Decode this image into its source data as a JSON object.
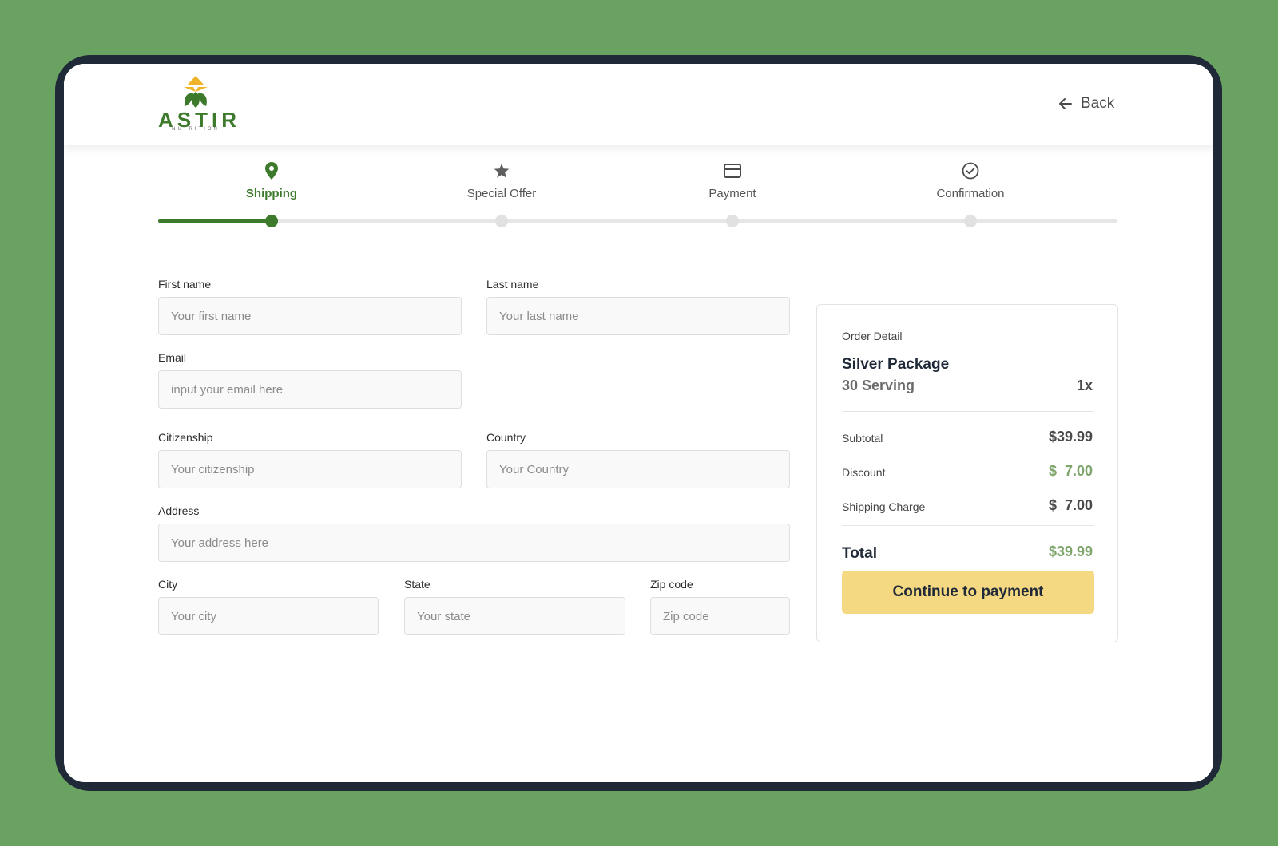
{
  "brand": {
    "name": "ASTIR",
    "tagline": "NUTRITION",
    "colors": {
      "primary_green": "#3d7a2b",
      "accent_yellow": "#f0b429",
      "button_yellow": "#f5d982",
      "page_background": "#6aa262"
    }
  },
  "header": {
    "back_label": "Back",
    "back_icon": "arrow-left-icon"
  },
  "stepper": {
    "active_index": 0,
    "steps": [
      {
        "label": "Shipping",
        "icon": "map-pin-icon"
      },
      {
        "label": "Special Offer",
        "icon": "star-icon"
      },
      {
        "label": "Payment",
        "icon": "credit-card-icon"
      },
      {
        "label": "Confirmation",
        "icon": "check-circle-icon"
      }
    ]
  },
  "form": {
    "first_name": {
      "label": "First name",
      "placeholder": "Your first name",
      "value": ""
    },
    "last_name": {
      "label": "Last name",
      "placeholder": "Your last name",
      "value": ""
    },
    "email": {
      "label": "Email",
      "placeholder": "input your email here",
      "value": ""
    },
    "citizenship": {
      "label": "Citizenship",
      "placeholder": "Your citizenship",
      "value": ""
    },
    "country": {
      "label": "Country",
      "placeholder": "Your Country",
      "value": ""
    },
    "address": {
      "label": "Address",
      "placeholder": "Your address here",
      "value": ""
    },
    "city": {
      "label": "City",
      "placeholder": "Your city",
      "value": ""
    },
    "state": {
      "label": "State",
      "placeholder": "Your state",
      "value": ""
    },
    "zip": {
      "label": "Zip code",
      "placeholder": "Zip code",
      "value": ""
    }
  },
  "order": {
    "heading": "Order Detail",
    "package_name": "Silver Package",
    "serving": "30 Serving",
    "quantity": "1x",
    "subtotal_label": "Subtotal",
    "subtotal_value": "$39.99",
    "discount_label": "Discount",
    "discount_value": "$  7.00",
    "shipping_label": "Shipping Charge",
    "shipping_value": "$  7.00",
    "total_label": "Total",
    "total_value": "$39.99",
    "cta_label": "Continue to payment"
  }
}
